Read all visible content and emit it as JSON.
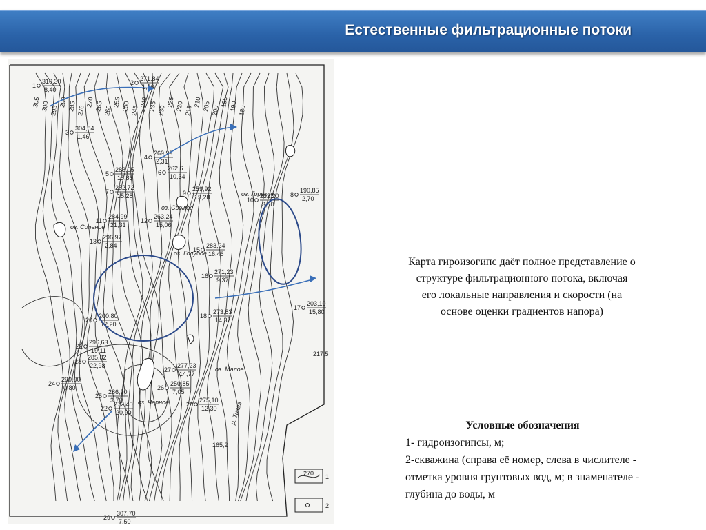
{
  "header": {
    "title": "Естественные фильтрационные потоки"
  },
  "map": {
    "lakes": [
      "оз. Соленое",
      "оз. Горькое",
      "оз. Свежее",
      "оз. Голубое",
      "оз. Малое",
      "оз. Черное"
    ],
    "river": "р. Тихая",
    "isolines": [
      "305",
      "300",
      "295",
      "290",
      "285",
      "276",
      "270",
      "265",
      "260",
      "255",
      "250",
      "245",
      "240",
      "235",
      "230",
      "225",
      "220",
      "215",
      "210",
      "205",
      "200",
      "195",
      "190",
      "180"
    ],
    "wells": [
      {
        "num": "1",
        "top": "310,30",
        "bottom": "8,40"
      },
      {
        "num": "2",
        "top": "271,84",
        "bottom": "1,36"
      },
      {
        "num": "3",
        "top": "304,84",
        "bottom": "1,46"
      },
      {
        "num": "4",
        "top": "269,99",
        "bottom": "2,31"
      },
      {
        "num": "5",
        "top": "283,05",
        "bottom": "15,86"
      },
      {
        "num": "6",
        "top": "262,6",
        "bottom": "10,34"
      },
      {
        "num": "7",
        "top": "282,72",
        "bottom": "15,28"
      },
      {
        "num": "8",
        "top": "190,85",
        "bottom": "2,70"
      },
      {
        "num": "9",
        "top": "259,92",
        "bottom": "15,28"
      },
      {
        "num": "10",
        "top": "232,20",
        "bottom": "3,30"
      },
      {
        "num": "11",
        "top": "284,99",
        "bottom": "21,31"
      },
      {
        "num": "12",
        "top": "263,24",
        "bottom": "15,06"
      },
      {
        "num": "13",
        "top": "296,97",
        "bottom": "2,84"
      },
      {
        "num": "15",
        "top": "283,24",
        "bottom": "16,46"
      },
      {
        "num": "16",
        "top": "271,23",
        "bottom": "9,37"
      },
      {
        "num": "17",
        "top": "203,10",
        "bottom": "15,80"
      },
      {
        "num": "18",
        "top": "273,83",
        "bottom": "14,37"
      },
      {
        "num": "20",
        "top": "200,80",
        "bottom": "12,20"
      },
      {
        "num": "21",
        "top": "296,63",
        "bottom": "19,11"
      },
      {
        "num": "22",
        "top": "272,40",
        "bottom": "20,90"
      },
      {
        "num": "23",
        "top": "285,82",
        "bottom": "22,98"
      },
      {
        "num": "24",
        "top": "290,00",
        "bottom": "0,80"
      },
      {
        "num": "25",
        "top": "286,20",
        "bottom": "3,70"
      },
      {
        "num": "26",
        "top": "250,85",
        "bottom": "7,05"
      },
      {
        "num": "27",
        "top": "277,23",
        "bottom": "14,77"
      },
      {
        "num": "28",
        "top": "275,10",
        "bottom": "12,30"
      },
      {
        "num": "29",
        "top": "307,70",
        "bottom": "7,50"
      }
    ],
    "spot_values": [
      "217,5",
      "165,2"
    ],
    "legend_keys": [
      "1",
      "2"
    ],
    "legend_sample": "270"
  },
  "description": "Карта гироизогипс даёт полное представление о структуре фильтрационного потока, включая его локальные направления и скорости (на основе оценки градиентов напора)",
  "legend": {
    "title": "Условные обозначения",
    "item1": "1- гидроизогипсы, м;",
    "item2": "2-скважина (справа её номер, слева в числителе - отметка уровня грунтовых вод, м; в знаменателе - глубина до воды, м"
  },
  "colors": {
    "title_bar": "#2a62a8",
    "arrows": "#3a6fb8",
    "ellipses": "#2c4a8a"
  }
}
